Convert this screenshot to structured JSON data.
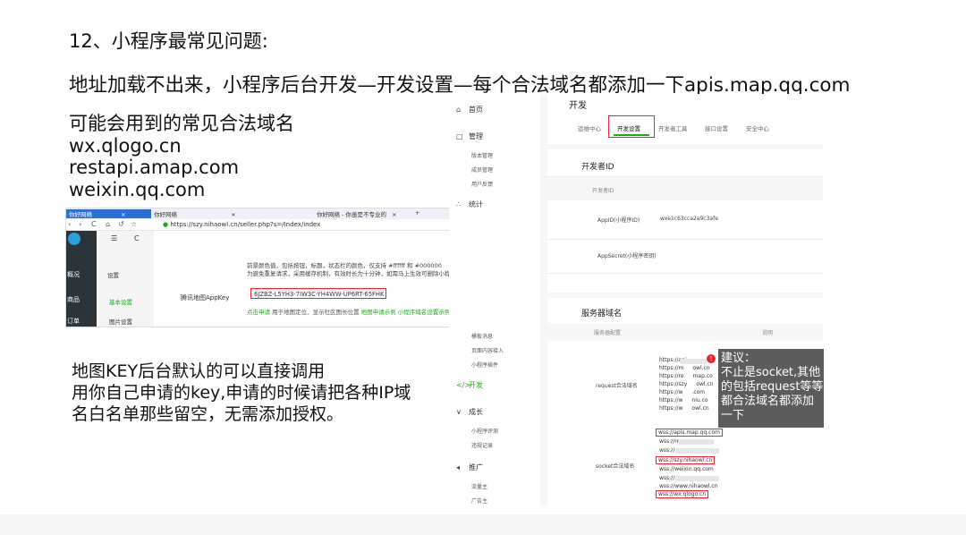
{
  "heading": "12、小程序最常见问题:",
  "problem": "地址加载不出来，小程序后台开发—开发设置—每个合法域名都添加一下apis.map.qq.com",
  "domains_title": "可能会用到的常见合法域名",
  "domains": [
    "wx.qlogo.cn",
    "restapi.amap.com",
    "weixin.qq.com"
  ],
  "note_lines": [
    "地图KEY后台默认的可以直接调用",
    "用你自己申请的key,申请的时候请把各种IP域",
    "名白名单那些留空，无需添加授权。"
  ],
  "browser": {
    "tabs": [
      "你好网络",
      "你好网络",
      "你好网络 - 你虽是不专业的"
    ],
    "tab_close": "×",
    "tab_add": "+",
    "url": "https://szy.nihaowl.cn/seller.php?s=/Index/index",
    "nav_back": "‹",
    "nav_forward": "›",
    "nav_refresh": "C",
    "nav_home": "⌂",
    "nav_history": "↺",
    "nav_star": "☆",
    "menu_icon": "☰",
    "refresh_icon": "C",
    "left_menu": [
      "概况",
      "商品",
      "订单"
    ],
    "second_menu": [
      "设置",
      "基本设置",
      "图片设置"
    ],
    "field_label": "腾讯地图AppKey",
    "desc_line1": "前景颜色值，包括按钮，标题，状态栏的颜色，仅支持 #ffffff 和 #000000",
    "desc_line2": "为避免重复请求，采用缓存机制，有效时长为十分钟，如需马上生效可删除小程序重新进入",
    "key_value": "6JZBZ-L5YH3-7IW3C-YH4WW-UP6RT-65FHK",
    "link_apply": "点击申请",
    "link_text": "用于地图定位、显示社区图长位置",
    "link_example": "地图申请示例",
    "link_domain": "小程序域名设置示例"
  },
  "admin": {
    "sidebar": {
      "home": "首页",
      "manage": "管理",
      "manage_subs": [
        "版本管理",
        "成员管理",
        "用户反馈"
      ],
      "stats": "统计",
      "mid_subs": [
        "模板消息",
        "页面内容接入",
        "小程序插件"
      ],
      "dev": "开发",
      "grow": "成长",
      "grow_subs": [
        "小程序评测",
        "违规记录"
      ],
      "promote": "推广",
      "promote_subs": [
        "流量主",
        "广告主"
      ]
    },
    "page_title": "开发",
    "tabs": [
      "运维中心",
      "开发设置",
      "开发者工具",
      "接口设置",
      "安全中心"
    ],
    "devid_title": "开发者ID",
    "devid_col": "开发者ID",
    "appid_label": "AppID(小程序ID)",
    "appid_value": "wxe1c63cca2a9c3afe",
    "secret_label": "AppSecret(小程序密钥)",
    "server_title": "服务器域名",
    "server_col": "服务器配置",
    "server_col2": "说明",
    "request_label": "request合法域名",
    "request_domains": [
      "https://api",
      "https://m",
      "https://re",
      "https://szy",
      "https://w",
      "https://w",
      "https://w"
    ],
    "request_suffixes": [
      "",
      "owl.cn",
      "map.co",
      "owl.cn",
      ".com",
      "niu.co",
      "owl.cn"
    ],
    "socket_label": "socket合法域名",
    "socket_domains": [
      "wss://apis.map.qq.com",
      "wss://re",
      "wss://r",
      "wss://szy.nihaowl.cn",
      "wss://weixin.qq.com",
      "wss://",
      "wss://www.nihaowl.cn",
      "wss://wx.qlogo.cn"
    ],
    "tip_dot": "!",
    "tip_lines": [
      "建议：",
      "不止是socket,其他",
      "的包括request等等",
      "都合法域名都添加",
      "一下"
    ]
  },
  "colors": {
    "accent_green": "#1aad19",
    "highlight_red": "#e23",
    "tooltip_bg": "#555555",
    "link_blue": "#2b6fd6"
  }
}
